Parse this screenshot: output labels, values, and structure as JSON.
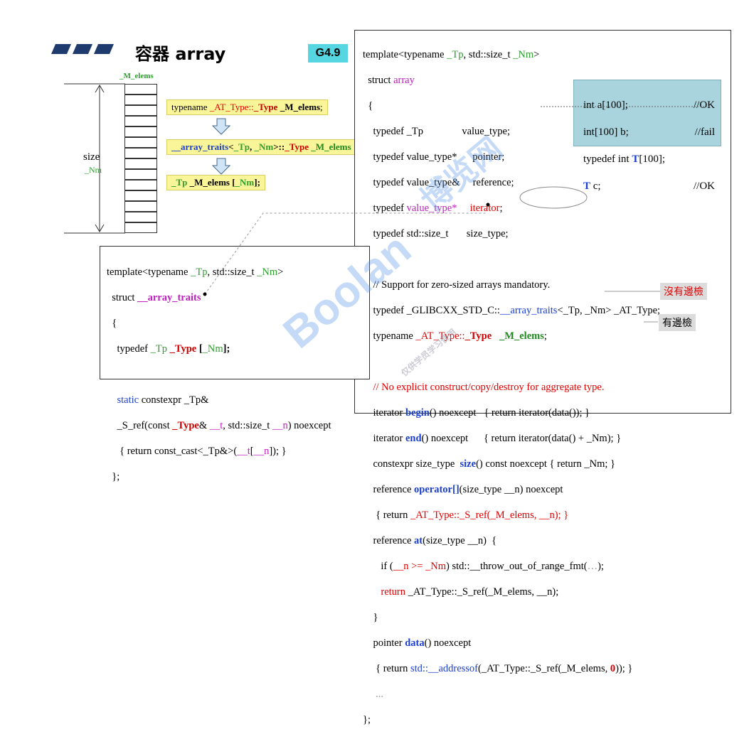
{
  "title": {
    "icons": "▰▰▰",
    "text": "容器 array"
  },
  "version_badge": "G4.9",
  "diagram": {
    "top_label": "_M_elems",
    "size_label": "size",
    "size_sub": "_Nm",
    "box1_prefix": "typename ",
    "box1_type": "_AT_Type::",
    "box1_keyword": "_Type",
    "box1_member": " _M_elems",
    "box1_semicolon": ";",
    "box2_name": "__array_traits",
    "box2_args_open": "<",
    "box2_tp": "_Tp",
    "box2_comma": ", ",
    "box2_nm": "_Nm",
    "box2_args_close": ">::",
    "box2_type": "_Type",
    "box2_member": " _M_elems",
    "box3_tp": "_Tp",
    "box3_rest": " _M_elems [",
    "box3_nm": "_Nm",
    "box3_close": "];"
  },
  "main_code": {
    "l1a": "template<typename ",
    "l1b": "_Tp",
    "l1c": ", std::size_t ",
    "l1d": "_Nm",
    "l1e": ">",
    "l2a": "  struct ",
    "l2b": "array",
    "l3": "  {",
    "l4": "    typedef _Tp               value_type;",
    "l5": "    typedef value_type*      pointer;",
    "l6": "    typedef value_type&     reference;",
    "l7a": "    typedef ",
    "l7b": "value_type*",
    "l7c": "     ",
    "l7d": "iterator",
    "l7e": ";",
    "l8": "    typedef std::size_t       size_type;",
    "l9": "    // Support for zero-sized arrays mandatory.",
    "l10a": "    typedef _GLIBCXX_STD_C::",
    "l10b": "__array_traits",
    "l10c": "<_Tp, _Nm> _AT_Type;",
    "l11a": "    typename ",
    "l11b": "_AT_Type::",
    "l11c": "_Type",
    "l11d": "   _M_elems",
    "l11e": ";",
    "l12": "    // No explicit construct/copy/destroy for aggregate type.",
    "l13a": "    iterator ",
    "l13b": "begin",
    "l13c": "() noexcept   { return iterator(data()); }",
    "l14a": "    iterator ",
    "l14b": "end",
    "l14c": "() noexcept      { return iterator(data() + _Nm); }",
    "l15a": "    constexpr size_type  ",
    "l15b": "size",
    "l15c": "() const noexcept { return _Nm; }",
    "l16a": "    reference ",
    "l16b": "operator[]",
    "l16c": "(size_type __n) noexcept",
    "l17a": "     { return ",
    "l17b": "_AT_Type::_S_ref(_M_elems, __n); }",
    "l18a": "    reference ",
    "l18b": "at",
    "l18c": "(size_type __n)  {",
    "l19a": "       if (",
    "l19b": "__n >= _Nm",
    "l19c": ") std::__throw_out_of_range_fmt(",
    "l19d": "…",
    "l19e": ");",
    "l20a": "       ",
    "l20b": "return",
    "l20c": " _AT_Type::_S_ref(_M_elems, __n);",
    "l21": "    }",
    "l22a": "    pointer ",
    "l22b": "data",
    "l22c": "() noexcept",
    "l23a": "     { return ",
    "l23b": "std::__addressof",
    "l23c": "(_AT_Type::_S_ref(_M_elems, ",
    "l23d": "0",
    "l23e": ")); }",
    "l24": "     ...",
    "l25": "};"
  },
  "note_box": {
    "l1a": "int a[100];",
    "l1b": "//OK",
    "l2a": "int[100] b;",
    "l2b": "//fail",
    "l3a": "typedef int ",
    "l3b": "T",
    "l3c": "[100];",
    "l4a": "T",
    "l4b": " c;",
    "l4c": "//OK"
  },
  "traits_code": {
    "l1a": "template<typename ",
    "l1b": "_Tp",
    "l1c": ", std::size_t ",
    "l1d": "_Nm",
    "l1e": ">",
    "l2a": "  struct ",
    "l2b": "__array_traits",
    "l3": "  {",
    "l4a": "    typedef ",
    "l4b": "_Tp",
    "l4c": " ",
    "l4d": "_Type",
    "l4e": " [",
    "l4f": "_Nm",
    "l4g": "];",
    "l5a": "    ",
    "l5b": "static",
    "l5c": " constexpr _Tp&",
    "l6a": "    _S_ref(const ",
    "l6b": "_Type",
    "l6c": "& ",
    "l6d": "__t",
    "l6e": ", std::size_t ",
    "l6f": "__n",
    "l6g": ") noexcept",
    "l7a": "     { return const_cast<_Tp&>(",
    "l7b": "__t",
    "l7c": "[",
    "l7d": "__n",
    "l7e": "]); }",
    "l8": "  };"
  },
  "tags": {
    "no_check": "沒有邊檢",
    "has_check": "有邊檢"
  },
  "watermark": {
    "brand": "Boolan",
    "cn": "博览网",
    "small": "仅供学员学习使用"
  }
}
